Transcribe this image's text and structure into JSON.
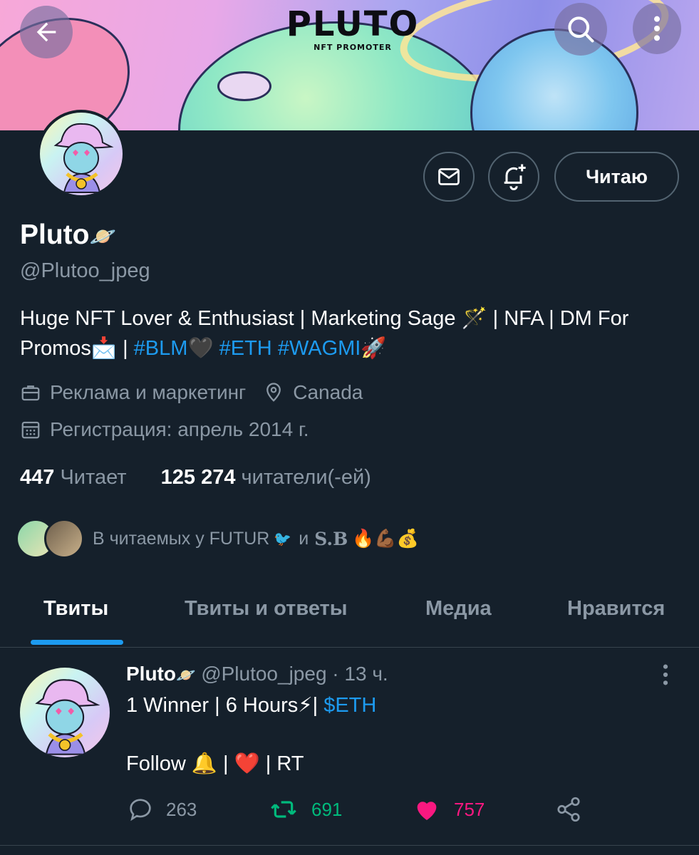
{
  "banner": {
    "logo_title": "PLUTO",
    "logo_subtitle": "NFT PROMOTER"
  },
  "header": {
    "back": "back-arrow",
    "search": "search-icon",
    "more": "more-vertical-icon"
  },
  "profile": {
    "name": "Pluto",
    "name_emoji": "🪐",
    "handle": "@Plutoo_jpeg",
    "follow_button": "Читаю",
    "bio": {
      "part1": "Huge NFT Lover & Enthusiast | Marketing Sage 🪄 | NFA | DM For Promos📩 | ",
      "tag1": "#BLM",
      "heart": "🖤",
      "tag2": "#ETH",
      "tag3": "#WAGMI",
      "rocket": "🚀"
    },
    "category": "Реклама и маркетинг",
    "location": "Canada",
    "joined": "Регистрация: апрель 2014 г.",
    "following_count": "447",
    "following_label": "Читает",
    "followers_count": "125 274",
    "followers_label": "читатели(-ей)",
    "followed_by": {
      "prefix": "В читаемых у FUTUR",
      "bird": "🐦",
      "and": "и",
      "name2": "S.B",
      "emojis": "🔥💪🏾💰"
    }
  },
  "tabs": [
    {
      "label": "Твиты",
      "active": true
    },
    {
      "label": "Твиты и ответы",
      "active": false
    },
    {
      "label": "Медиа",
      "active": false
    },
    {
      "label": "Нравится",
      "active": false
    }
  ],
  "tweet": {
    "name": "Pluto",
    "name_emoji": "🪐",
    "handle": "@Plutoo_jpeg",
    "time": "· 13 ч.",
    "line1_text": "1 Winner | 6 Hours⚡| ",
    "line1_link": "$ETH",
    "line2": "Follow 🔔 | ❤️ | RT",
    "replies": "263",
    "retweets": "691",
    "likes": "757"
  },
  "colors": {
    "accent": "#1d9bf0",
    "background": "#15202b",
    "muted": "#8b98a5",
    "retweet": "#00ba7c",
    "like": "#f91880"
  }
}
